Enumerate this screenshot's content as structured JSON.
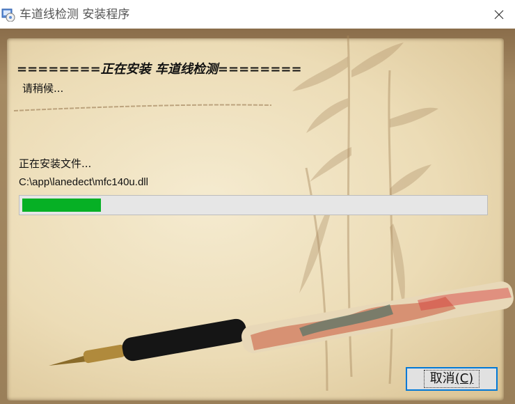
{
  "window": {
    "title": "车道线检测 安装程序",
    "close_icon": "close-icon"
  },
  "install": {
    "heading": "========正在安装 车道线检测========",
    "wait_text": "请稍候...",
    "status_text": "正在安装文件...",
    "current_file": "C:\\app\\lanedect\\mfc140u.dll",
    "progress_fraction": 0.17
  },
  "buttons": {
    "cancel_label": "取消",
    "cancel_shortcut": "(C)"
  },
  "colors": {
    "progress_fill": "#06b025",
    "progress_track": "#e6e6e6",
    "button_focus_border": "#0078d7"
  }
}
